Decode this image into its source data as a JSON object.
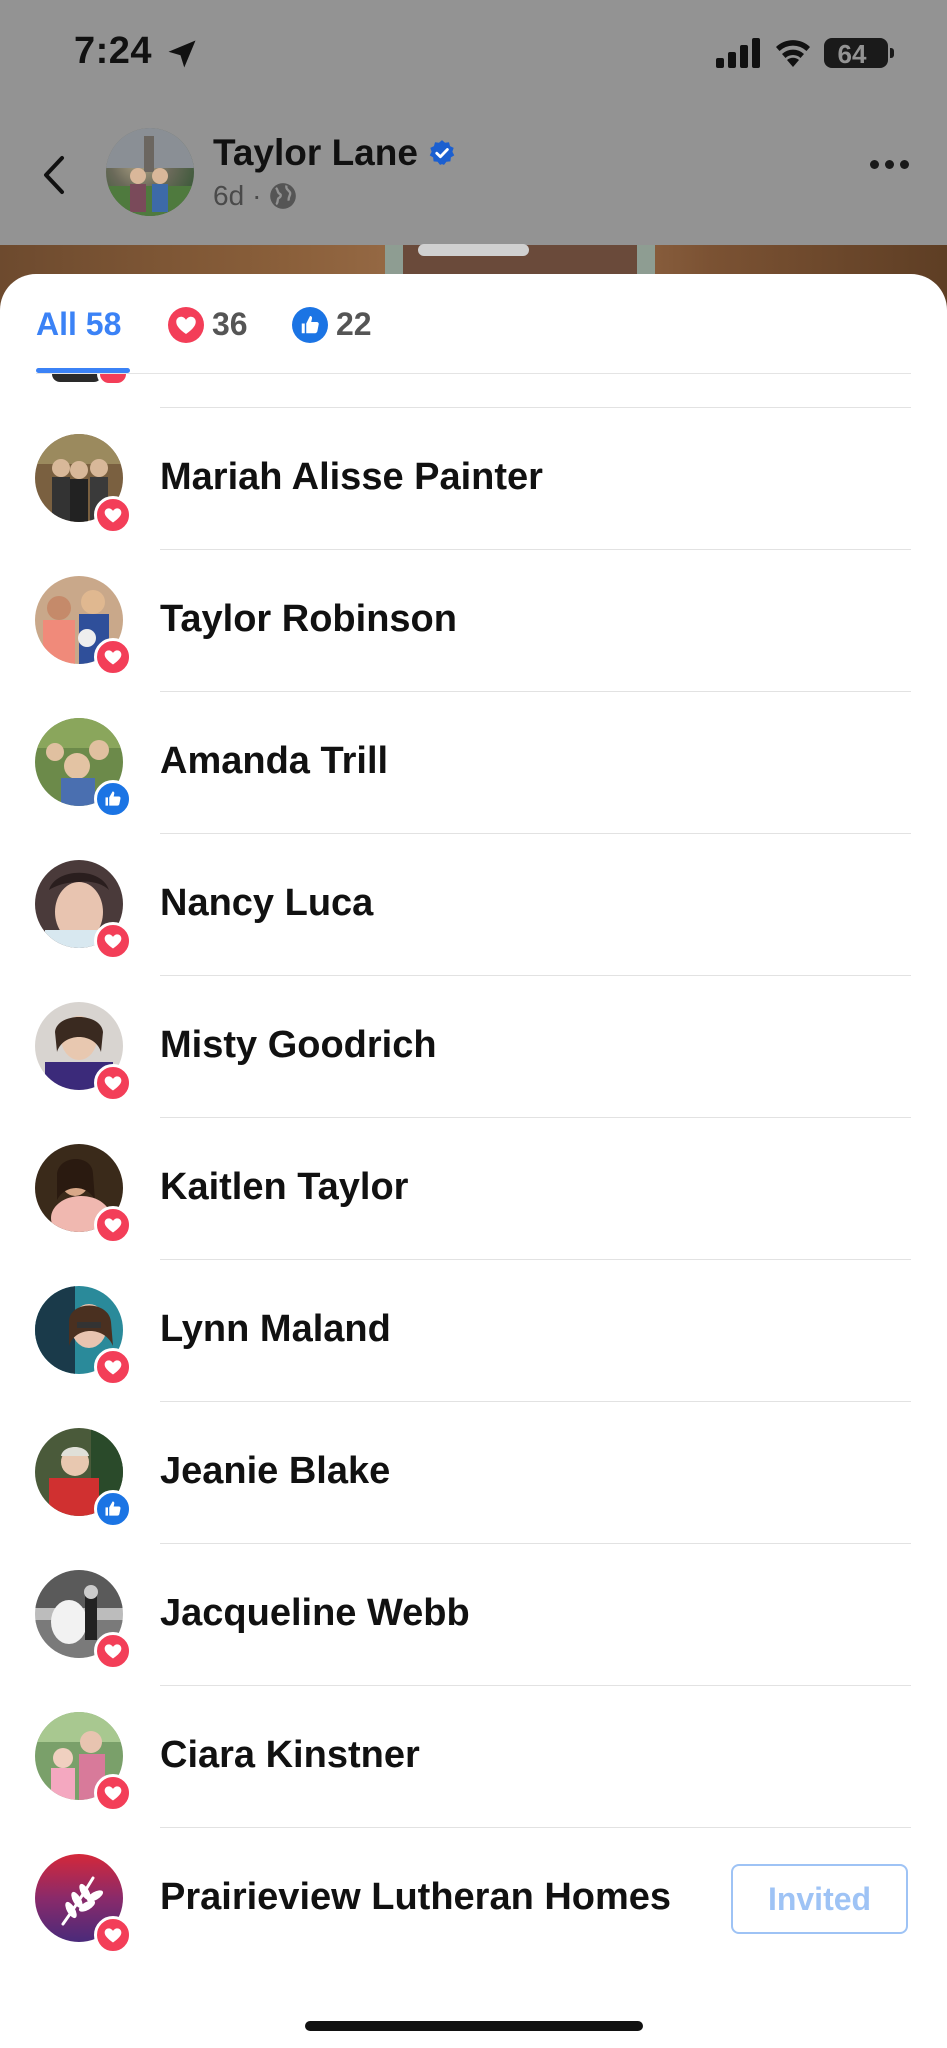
{
  "status_bar": {
    "time": "7:24",
    "battery": "64",
    "location_icon": "location-arrow-icon",
    "signal_icon": "cellular-signal-icon",
    "wifi_icon": "wifi-icon"
  },
  "post_header": {
    "name": "Taylor Lane",
    "age": "6d",
    "separator": "·",
    "privacy_icon": "globe-icon",
    "verified_icon": "verified-badge-icon",
    "back_icon": "chevron-left-icon",
    "more_icon": "more-dots-icon"
  },
  "tabs": [
    {
      "label": "All 58",
      "icon": null,
      "active": true
    },
    {
      "label": "36",
      "icon": "love-reaction-icon",
      "active": false
    },
    {
      "label": "22",
      "icon": "like-reaction-icon",
      "active": false
    }
  ],
  "reactions": [
    {
      "name": "Mariah Alisse Painter",
      "reaction": "love"
    },
    {
      "name": "Taylor Robinson",
      "reaction": "love"
    },
    {
      "name": "Amanda Trill",
      "reaction": "like"
    },
    {
      "name": "Nancy Luca",
      "reaction": "love"
    },
    {
      "name": "Misty Goodrich",
      "reaction": "love"
    },
    {
      "name": "Kaitlen Taylor",
      "reaction": "love"
    },
    {
      "name": "Lynn Maland",
      "reaction": "love"
    },
    {
      "name": "Jeanie Blake",
      "reaction": "like"
    },
    {
      "name": "Jacqueline Webb",
      "reaction": "love"
    },
    {
      "name": "Ciara Kinstner",
      "reaction": "love"
    },
    {
      "name": "Prairieview Lutheran Homes",
      "reaction": "love",
      "action": "Invited"
    }
  ],
  "colors": {
    "accent": "#3b82f6",
    "love": "#f33e58",
    "like": "#1b74e4",
    "invited_border": "#9ec3f5"
  }
}
